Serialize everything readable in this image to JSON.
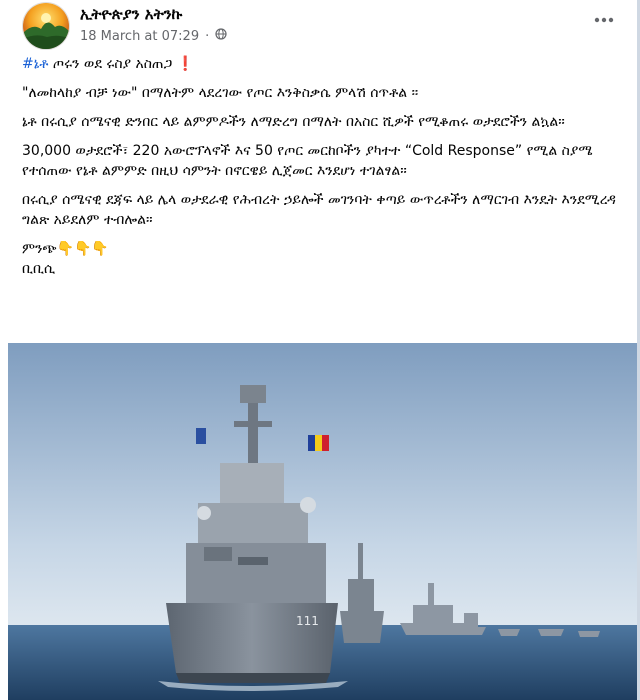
{
  "post": {
    "page_name": "ኢትዮጵያን አትንኩ",
    "timestamp": "18 March at 07:29",
    "separator": "·",
    "hashtag": "#ኔቶ",
    "headline_rest": " ጦሩን ወደ ሩስያ አስጠጋ",
    "headline_mark": "❗",
    "paragraphs": [
      "\"ለመከላከያ ብቻ ነው\" በማለትም ላደረገው የጦር እንቅስቃሴ ምላሽ ሰጥቶል ፡፡",
      "ኔቶ በሩሲያ ሰሜናዊ ድንበር ላይ ልምምዶችን ለማድረግ በማለት በአስር ሺዎች የሚቆጠሩ ወታደሮችን ልኳል።",
      "30,000 ወታደሮች፣ 220 አውሮፕላኖች እና 50 የጦር መርከቦችን ያካተተ “Cold Response” የሚል ስያሜ የተሰጠው የኔቶ ልምምድ በዚህ ሳምንት በኖርዌይ ሊጀመር እንደሆነ ተገልፃል።",
      "በሩሲያ ሰሜናዊ ደጃፍ ላይ ሌላ ወታደራዊ የሕብረት ኃይሎች መገንባት ቀጣይ ውጥረቶችን ለማርገብ እንዴት እንደሚረዳ ግልጽ አይደለም ተብሎል።"
    ],
    "source_label": "ምንጭ👇👇👇",
    "source_name": "ቢቢሲ"
  },
  "icons": {
    "more": "more-options-icon",
    "privacy": "globe-icon",
    "avatar": "page-avatar"
  },
  "photo": {
    "ship_number": "111",
    "accent_colors": {
      "sky": "#9fb8d2",
      "sea": "#2f5277",
      "hull": "#6b7480"
    }
  }
}
